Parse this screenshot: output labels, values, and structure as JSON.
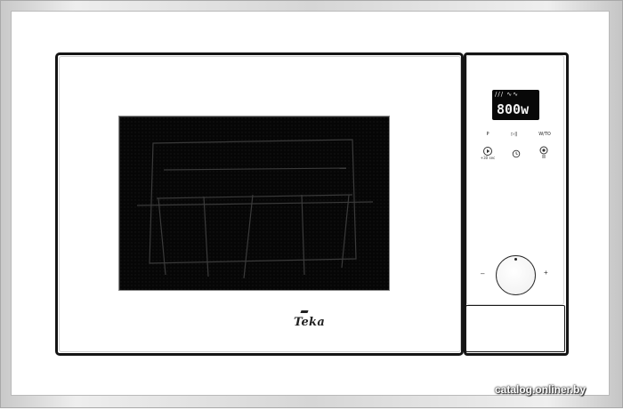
{
  "product": {
    "brand_logo": "Teka",
    "display": {
      "icons": "/// ∿∿",
      "power": "800w"
    },
    "buttons": [
      {
        "label": "P",
        "icon": "play-icon",
        "sub": "+30 sec"
      },
      {
        "label": "▷||",
        "icon": "clock-icon",
        "sub": ""
      },
      {
        "label": "W/TO",
        "icon": "defrost-icon",
        "sub": ""
      }
    ],
    "knob": {
      "minus": "–",
      "plus": "+"
    }
  },
  "watermark": "catalog.onliner.by",
  "colors": {
    "body": "#ffffff",
    "trim": "#151515",
    "frame": "#d6d6d6",
    "display_bg": "#080808",
    "window": "#070707"
  }
}
